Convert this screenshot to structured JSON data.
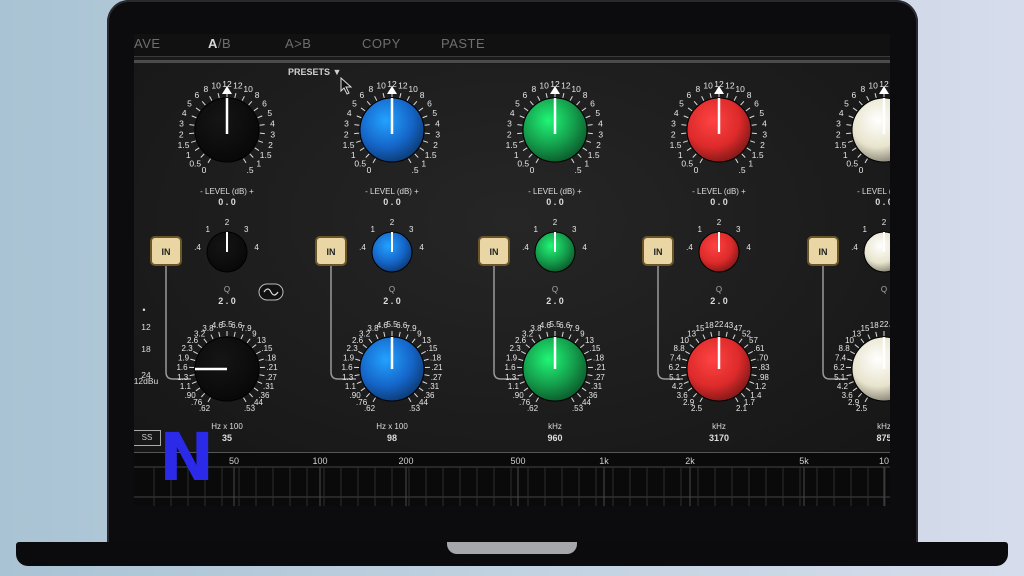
{
  "toolbar": {
    "save": "AVE",
    "ab": "A",
    "ab_sep": "/B",
    "a_to_b": "A>B",
    "copy": "COPY",
    "paste": "PASTE"
  },
  "presets_label": "PRESETS",
  "level_label": "- LEVEL (dB) +",
  "level_value": "0 . 0",
  "q_label": "Q",
  "in_label": "IN",
  "ss_label": "SS",
  "logo_letter": "N",
  "level_ticks": [
    "0",
    "0.5",
    "1",
    "1.5",
    "2",
    "3",
    "4",
    "5",
    "6",
    "8",
    "10",
    "12",
    "12",
    "10",
    "8",
    "6",
    "5",
    "4",
    "3",
    "2",
    "1.5",
    "1",
    ".5"
  ],
  "bands": [
    {
      "color": "#0d0d0d",
      "q_value": "2 . 0",
      "freq_unit": "Hz x 100",
      "freq_value": "35",
      "freq_ticks": [
        ".62",
        ".76",
        ".90",
        "1.1",
        "1.3",
        "1.6",
        "1.9",
        "2.3",
        "2.6",
        "3.2",
        "3.8",
        "4.6",
        "5.5",
        "6.6",
        "7.9",
        "9",
        "13",
        ".15",
        ".18",
        ".21",
        ".27",
        ".31",
        ".36",
        ".44",
        ".53"
      ]
    },
    {
      "color": "#1565c8",
      "q_value": "2 . 0",
      "freq_unit": "Hz x 100",
      "freq_value": "98",
      "freq_ticks": [
        ".62",
        ".76",
        ".90",
        "1.1",
        "1.3",
        "1.6",
        "1.9",
        "2.3",
        "2.6",
        "3.2",
        "3.8",
        "4.6",
        "5.5",
        "6.6",
        "7.9",
        "9",
        "13",
        ".15",
        ".18",
        ".21",
        ".27",
        ".31",
        ".36",
        ".44",
        ".53"
      ]
    },
    {
      "color": "#149a4a",
      "q_value": "2 . 0",
      "freq_unit": "kHz",
      "freq_value": "960",
      "freq_ticks": [
        ".62",
        ".76",
        ".90",
        "1.1",
        "1.3",
        "1.6",
        "1.9",
        "2.3",
        "2.6",
        "3.2",
        "3.8",
        "4.6",
        "5.5",
        "6.6",
        "7.9",
        "9",
        "13",
        ".15",
        ".18",
        ".21",
        ".27",
        ".31",
        ".36",
        ".44",
        ".53"
      ]
    },
    {
      "color": "#dd2a2a",
      "q_value": "2 . 0",
      "freq_unit": "kHz",
      "freq_value": "3170",
      "freq_ticks": [
        "2.5",
        "2.9",
        "3.6",
        "4.2",
        "5.1",
        "6.2",
        "7.4",
        "8.8",
        "10",
        "13",
        "15",
        "18",
        "22",
        "43",
        "47",
        "52",
        "57",
        ".61",
        ".70",
        ".83",
        ".98",
        "1.2",
        "1.4",
        "1.7",
        "2.1"
      ]
    },
    {
      "color": "#e8e4cc",
      "q_value": "",
      "freq_unit": "kHz",
      "freq_value": "875",
      "freq_ticks": [
        "2.5",
        "2.9",
        "3.6",
        "4.2",
        "5.1",
        "6.2",
        "7.4",
        "8.8",
        "10",
        "13",
        "15",
        "18",
        "22",
        "43",
        "47",
        "52",
        "57",
        ".61",
        ".70",
        ".83",
        ".98",
        "1.2",
        "1.4",
        "1.7",
        "2.1"
      ]
    }
  ],
  "left_scale": [
    "12",
    "18",
    "24",
    "12dBu"
  ],
  "graph_labels": [
    "50",
    "100",
    "200",
    "500",
    "1k",
    "2k",
    "5k",
    "10"
  ]
}
